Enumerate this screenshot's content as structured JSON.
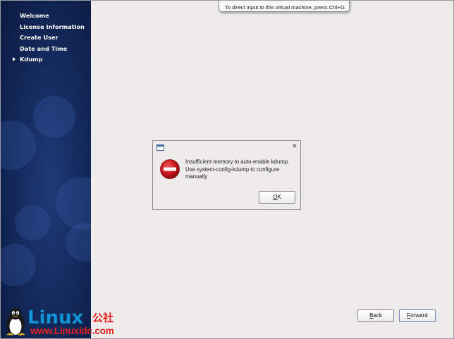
{
  "sidebar": {
    "items": [
      {
        "label": "Welcome"
      },
      {
        "label": "License Information"
      },
      {
        "label": "Create User"
      },
      {
        "label": "Date and Time"
      },
      {
        "label": "Kdump",
        "current": true
      }
    ]
  },
  "tooltip": {
    "text": "To direct input to this virtual machine, press Ctrl+G."
  },
  "dialog": {
    "message": "Insufficient memory to auto-enable kdump. Use system-config-kdump to configure manually",
    "ok_accel": "O",
    "ok_rest": "K"
  },
  "footer": {
    "back_accel": "B",
    "back_rest": "ack",
    "forward_accel": "F",
    "forward_rest": "orward"
  },
  "watermark": {
    "logo_text": "Linux",
    "logo_cjk": "公社",
    "site": "www.Linuxidc.com"
  },
  "colors": {
    "sidebar_bg": "#142b5e",
    "panel_bg": "#edecea",
    "error_red": "#c8161d",
    "watermark_blue": "#1296d8",
    "watermark_red": "#e62020"
  }
}
